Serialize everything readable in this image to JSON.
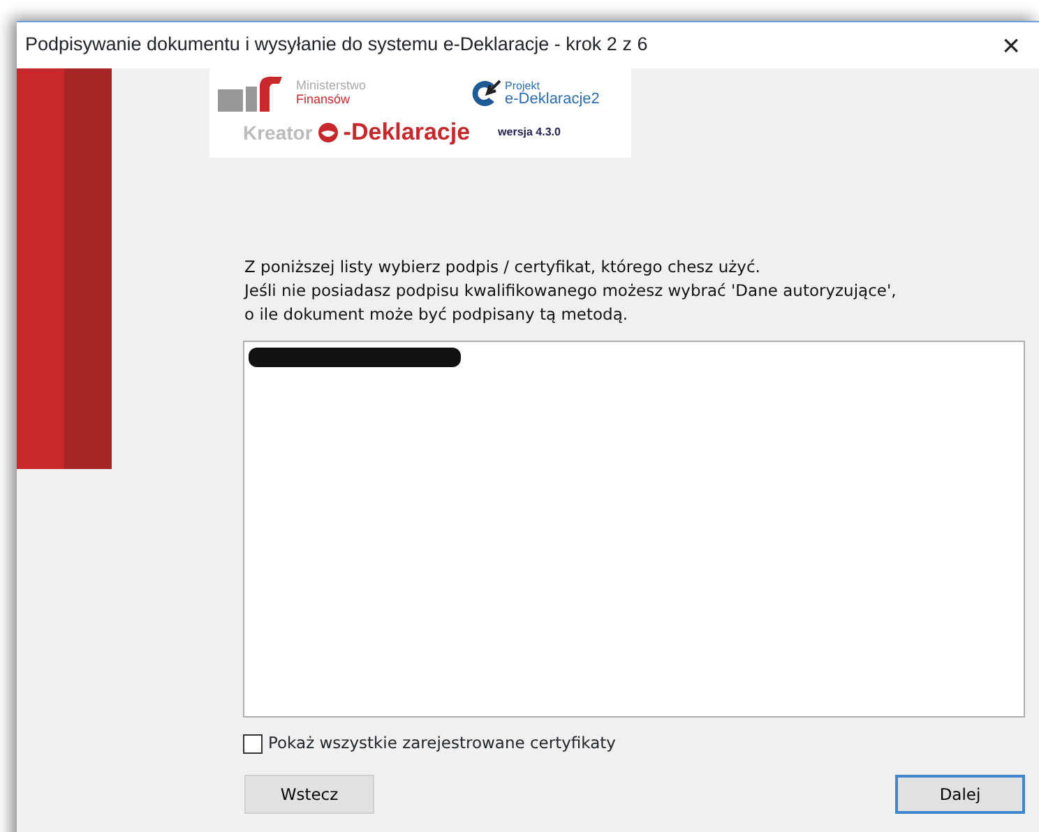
{
  "window": {
    "title": "Podpisywanie dokumentu i wysyłanie do systemu e-Deklaracje - krok 2 z 6",
    "close": "×"
  },
  "logo": {
    "ministry_line1": "Ministerstwo",
    "ministry_line2": "Finansów",
    "kreator": "Kreator",
    "product": "-Deklaracje",
    "project_line1": "Projekt",
    "project_line2": "e-Deklaracje2",
    "version": "wersja 4.3.0"
  },
  "instructions": [
    "Z poniższej listy wybierz podpis / certyfikat, którego chesz użyć.",
    "Jeśli nie posiadasz podpisu kwalifikowanego możesz wybrać 'Dane autoryzujące',",
    "o ile dokument może być podpisany tą metodą."
  ],
  "certificates": [
    {
      "kind": "redacted"
    }
  ],
  "show_all": {
    "label": "Pokaż wszystkie zarejestrowane certyfikaty",
    "checked": false
  },
  "buttons": [
    {
      "label": "Wstecz",
      "default": false
    },
    {
      "label": "Dalej",
      "default": true
    }
  ]
}
